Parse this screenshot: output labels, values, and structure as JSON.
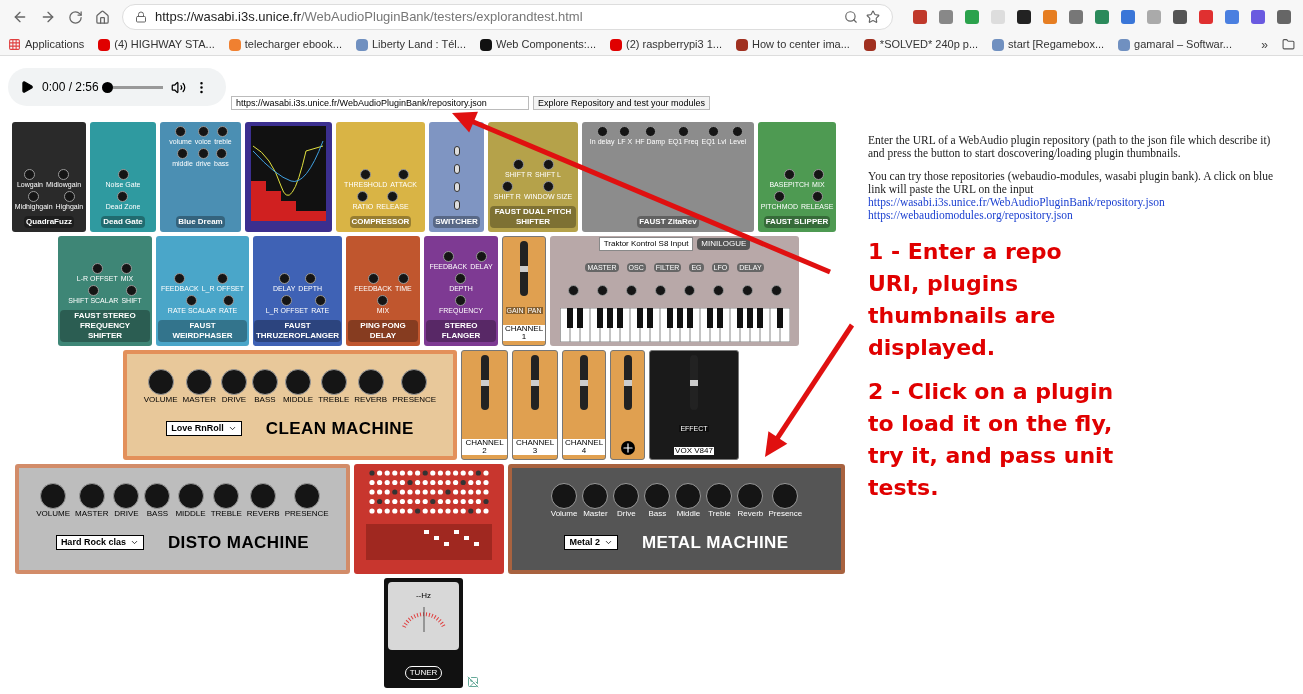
{
  "browser": {
    "url_host": "https://wasabi.i3s.unice.fr",
    "url_path": "/WebAudioPluginBank/testers/explorandtest.html",
    "bookmarks": [
      {
        "label": "Applications",
        "kind": "apps"
      },
      {
        "label": "(4) HIGHWAY STA...",
        "kind": "video"
      },
      {
        "label": "telecharger ebook...",
        "kind": "blog"
      },
      {
        "label": "Liberty Land : Tél...",
        "kind": "site"
      },
      {
        "label": "Web Components:...",
        "kind": "dev"
      },
      {
        "label": "(2) raspberrypi3 1...",
        "kind": "video"
      },
      {
        "label": "How to center ima...",
        "kind": "so"
      },
      {
        "label": "*SOLVED* 240p p...",
        "kind": "so"
      },
      {
        "label": "start [Regamebox...",
        "kind": "site"
      },
      {
        "label": "gamaral – Softwar...",
        "kind": "site"
      }
    ],
    "more": "»"
  },
  "player": {
    "time": "0:00 / 2:56",
    "level": 0
  },
  "repo_input": {
    "value": "https://wasabi.i3s.unice.fr/WebAudioPluginBank/repository.json"
  },
  "explore_button": "Explore Repository and test your modules",
  "rows": [
    {
      "items": [
        {
          "kind": "pedal",
          "title": "QuadraFuzz",
          "color": "#2a2a2a",
          "knobs": [
            "Lowgain",
            "Midlowgain",
            "Midhighgain",
            "Highgain"
          ]
        },
        {
          "kind": "pedal",
          "title": "Dead Gate",
          "color": "#2f9aa0",
          "knobs": [
            "Noise Gate",
            "Dead Zone"
          ]
        },
        {
          "kind": "pedal",
          "title": "Blue Dream",
          "color": "#4b8fb3",
          "knobs": [
            "volume",
            "voice",
            "treble",
            "middle",
            "drive",
            "bass"
          ]
        },
        {
          "kind": "eq",
          "color": "#3b2f8f"
        },
        {
          "kind": "pedal",
          "title": "COMPRESSOR",
          "color": "#d9b445",
          "knobs": [
            "THRESHOLD",
            "ATTACK",
            "RATIO",
            "RELEASE"
          ]
        },
        {
          "kind": "pedal",
          "title": "SWITCHER",
          "color": "#7f95c2"
        },
        {
          "kind": "pedal",
          "title": "FAUST DUAL PITCH SHIFTER",
          "color": "#b5a24a",
          "knobs": [
            "SHIFT R",
            "SHIFT L",
            "SHIFT R",
            "WINDOW SIZE"
          ]
        },
        {
          "kind": "pedal",
          "title": "FAUST ZitaRev",
          "color": "#8c8c8c",
          "knobs": [
            "In delay",
            "LF X",
            "HF Damp",
            "EQ1 Freq",
            "EQ1 Lvl",
            "Level"
          ]
        },
        {
          "kind": "pedal",
          "title": "FAUST SLIPPER",
          "color": "#4e9a52",
          "knobs": [
            "BASEPITCH",
            "MIX",
            "PITCHMOD",
            "RELEASE"
          ]
        }
      ]
    },
    {
      "items": [
        {
          "kind": "pedal",
          "title": "FAUST STEREO FREQUENCY SHIFTER",
          "color": "#3e8676",
          "knobs": [
            "L-R OFFSET",
            "MIX",
            "SHIFT SCALAR",
            "SHIFT"
          ]
        },
        {
          "kind": "pedal",
          "title": "FAUST WEIRDPHASER",
          "color": "#4aa6c9",
          "knobs": [
            "FEEDBACK",
            "L_R OFFSET",
            "RATE SCALAR",
            "RATE"
          ]
        },
        {
          "kind": "pedal",
          "title": "FAUST THRUZEROFLANGER",
          "color": "#3f62b5",
          "knobs": [
            "DELAY",
            "DEPTH",
            "L_R OFFSET",
            "RATE"
          ]
        },
        {
          "kind": "pedal",
          "title": "PING PONG DELAY",
          "color": "#c0562e",
          "knobs": [
            "FEEDBACK",
            "TIME",
            "MIX"
          ]
        },
        {
          "kind": "pedal",
          "title": "STEREO FLANGER",
          "color": "#7e3a93",
          "knobs": [
            "FEEDBACK",
            "DELAY",
            "DEPTH",
            "FREQUENCY"
          ]
        },
        {
          "kind": "fader",
          "title": "CHANNEL 1",
          "color": "#e0a050",
          "knobs": [
            "GAIN",
            "PAN"
          ]
        },
        {
          "kind": "keyboard",
          "title": "MINILOGUE",
          "color": "#b8a8a8",
          "select": "Traktor Kontrol S8 Input",
          "knobs": [
            "MASTER",
            "OSC",
            "FILTER",
            "EG",
            "LFO",
            "DELAY"
          ]
        }
      ]
    },
    {
      "items": [
        {
          "kind": "amp",
          "title": "CLEAN MACHINE",
          "color": "#e8c89a",
          "preset": "Love RnRoll",
          "knobs": [
            "VOLUME",
            "MASTER",
            "DRIVE",
            "BASS",
            "MIDDLE",
            "TREBLE",
            "REVERB",
            "PRESENCE"
          ]
        },
        {
          "kind": "fader",
          "title": "CHANNEL 2",
          "color": "#e0a050"
        },
        {
          "kind": "fader",
          "title": "CHANNEL 3",
          "color": "#e0a050"
        },
        {
          "kind": "fader",
          "title": "CHANNEL 4",
          "color": "#e0a050"
        },
        {
          "kind": "fader",
          "color": "#e0a050"
        },
        {
          "kind": "fader",
          "title": "VOX V847",
          "color": "#1a1a1a",
          "knobs": [
            "EFFECT"
          ]
        }
      ]
    },
    {
      "items": [
        {
          "kind": "amp",
          "title": "DISTO MACHINE",
          "color": "#bdbdbd",
          "preset": "Hard Rock clas",
          "knobs": [
            "VOLUME",
            "MASTER",
            "DRIVE",
            "BASS",
            "MIDDLE",
            "TREBLE",
            "REVERB",
            "PRESENCE"
          ]
        },
        {
          "kind": "sequencer",
          "color": "#c8362e"
        },
        {
          "kind": "amp",
          "title": "METAL MACHINE",
          "color": "#555555",
          "preset": "Metal 2",
          "knobs": [
            "Volume",
            "Master",
            "Drive",
            "Bass",
            "Middle",
            "Treble",
            "Reverb",
            "Presence"
          ]
        }
      ]
    },
    {
      "items": [
        {
          "kind": "tuner",
          "title": "TUNER",
          "color": "#111111",
          "reading": "--Hz"
        },
        {
          "kind": "broken"
        }
      ]
    }
  ],
  "info": {
    "intro": "Enter the URL of a WebAudio plugin repository (path to the json file which describe it) and press the button to start doscovering/loading plugin thumbnails.",
    "hint": "You can try those repositories (webaudio-modules, wasabi plugin bank). A click on blue link will paste the URL on the input",
    "links": [
      "https://wasabi.i3s.unice.fr/WebAudioPluginBank/repository.json",
      "https://webaudiomodules.org/repository.json"
    ]
  },
  "annotations": [
    "1 - Enter a repo URI, plugins thumbnails are displayed.",
    "2 - Click on a plugin to load it on the fly, try it, and pass unit tests."
  ]
}
